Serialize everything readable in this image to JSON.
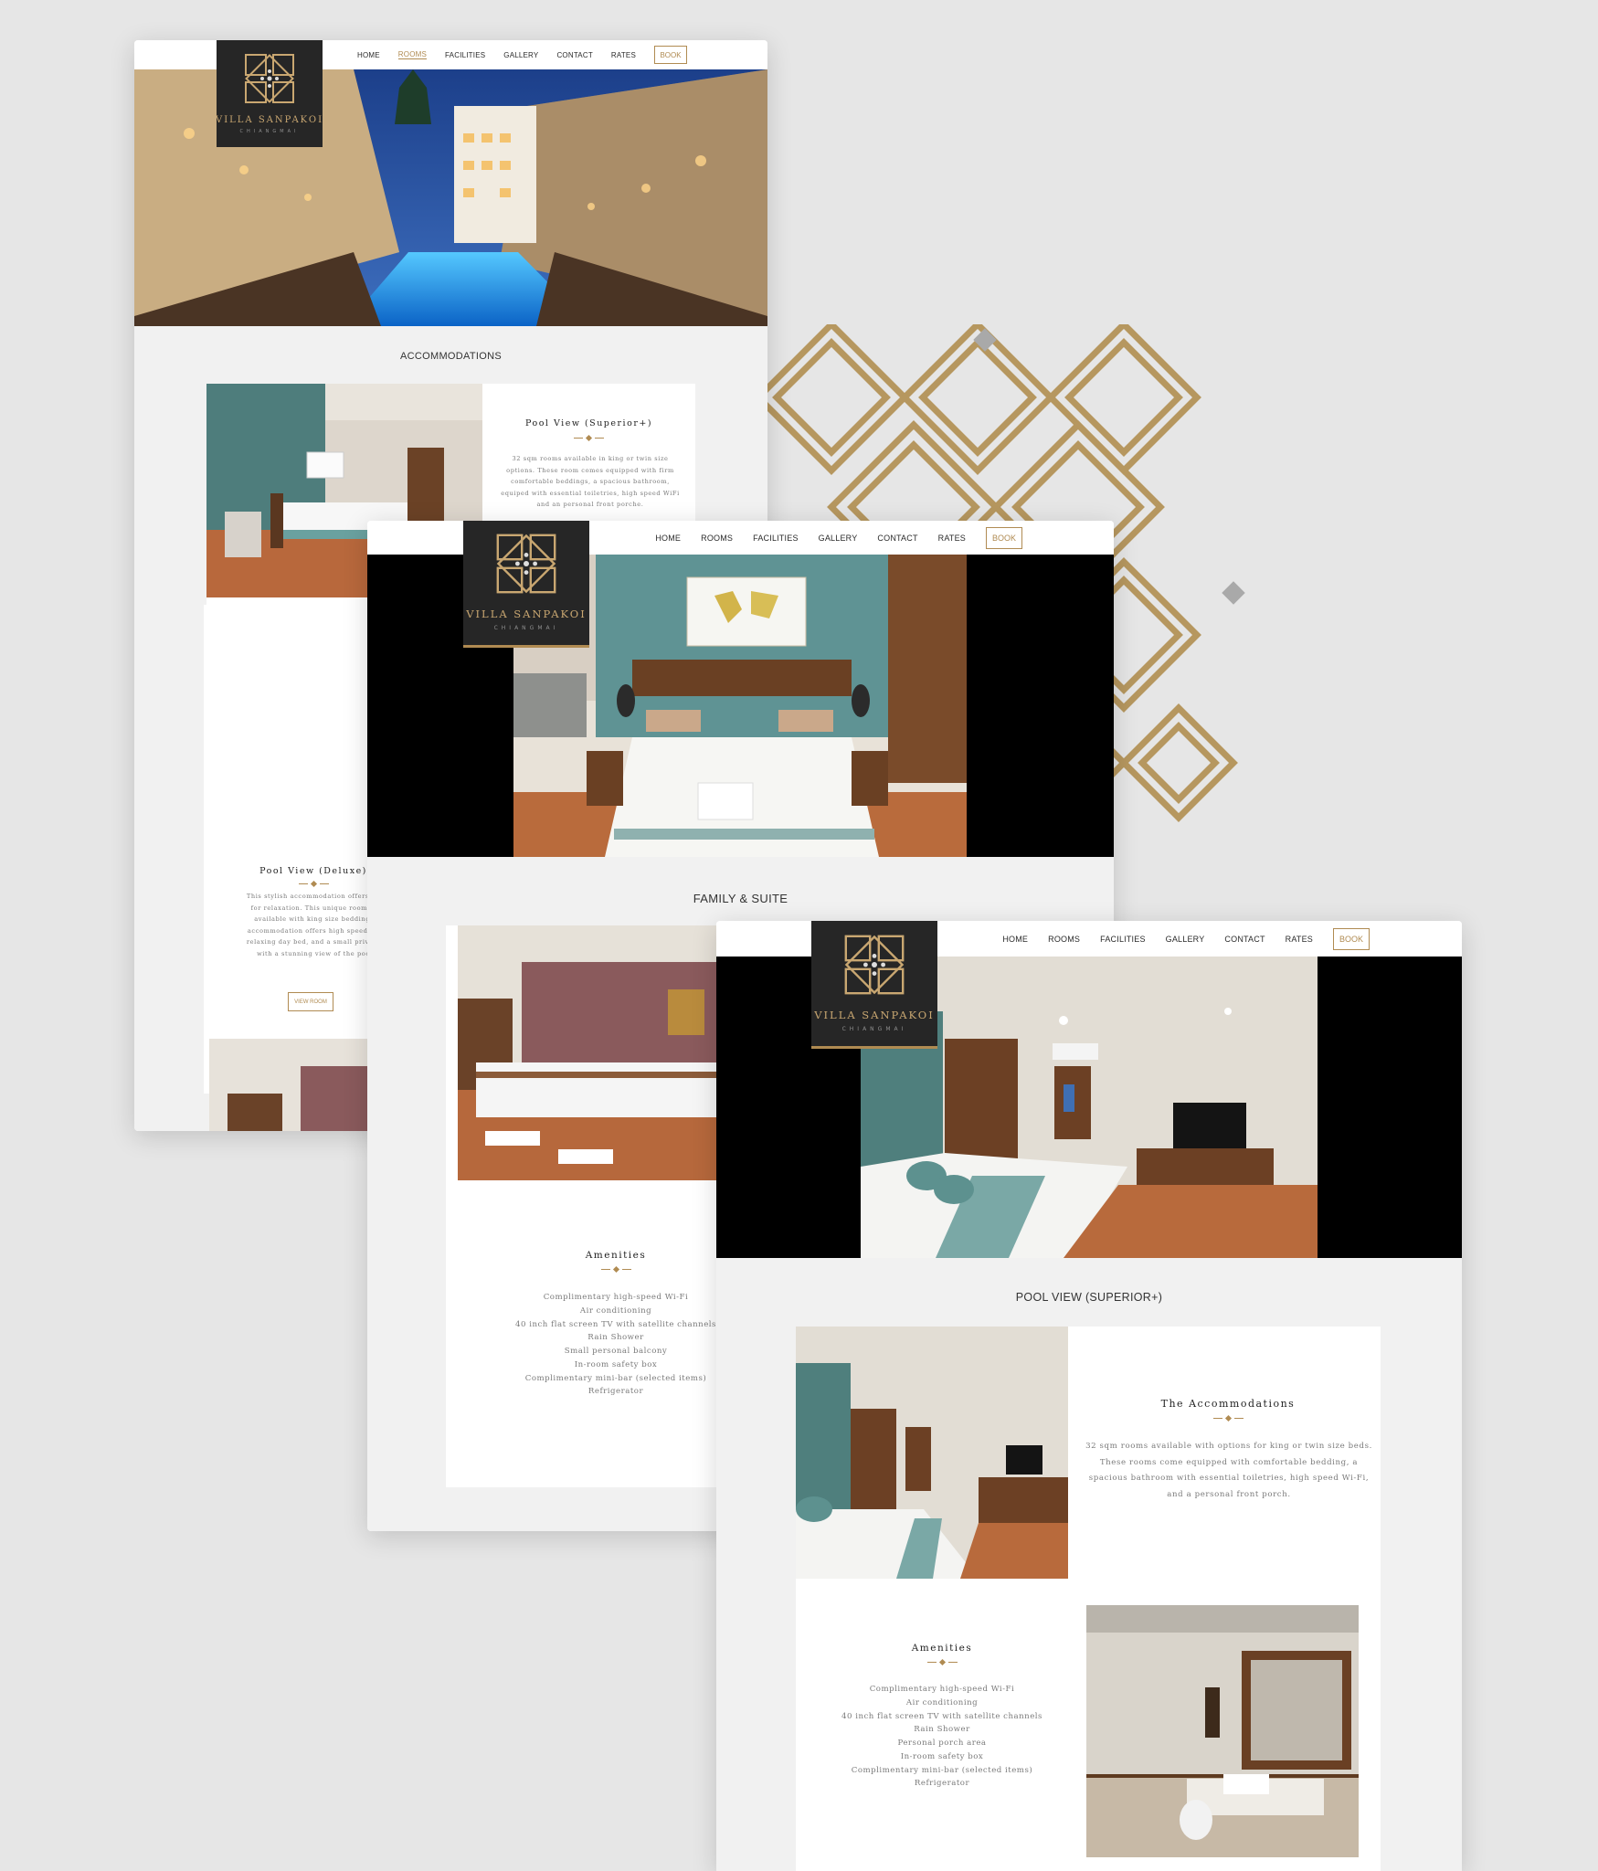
{
  "brand": {
    "name": "VILLA SANPAKOI",
    "location": "CHIANGMAI",
    "colors": {
      "gold": "#b08b52",
      "dark": "#262626",
      "background": "#e6e6e6"
    }
  },
  "nav": {
    "items": [
      "HOME",
      "ROOMS",
      "FACILITIES",
      "GALLERY",
      "CONTACT",
      "RATES"
    ],
    "book_label": "BOOK"
  },
  "screen1": {
    "active_nav": "ROOMS",
    "section_title": "ACCOMMODATIONS",
    "room1": {
      "title": "Pool View (Superior+)",
      "description": "32 sqm rooms available in king or twin size options. These room comes equipped with firm comfortable beddings, a spacious bathroom, equiped with essential toiletries, high speed WiFi and an personal front porche."
    },
    "room2": {
      "title": "Pool View (Deluxe)",
      "description_lines": [
        "This stylish accommodation offers 32",
        "for relaxation. This unique room is",
        "available with king size bedding.",
        "accommodation offers high speed Wi",
        "relaxing day bed, and a small private",
        "with a stunning view of the poo"
      ],
      "button_label": "VIEW ROOM"
    }
  },
  "screen2": {
    "section_title": "FAMILY & SUITE",
    "amenities_title": "Amenities",
    "amenities": [
      "Complimentary high-speed Wi-Fi",
      "Air conditioning",
      "40 inch flat screen TV with satellite channels",
      "Rain Shower",
      "Small personal balcony",
      "In-room safety box",
      "Complimentary mini-bar (selected items)",
      "Refrigerator"
    ]
  },
  "screen3": {
    "section_title": "POOL VIEW (SUPERIOR+)",
    "accommodations_title": "The Accommodations",
    "accommodations_text": "32 sqm rooms available with options for king or twin size beds. These rooms come equipped with comfortable bedding, a spacious bathroom with essential toiletries, high speed Wi-Fi, and a personal front porch.",
    "amenities_title": "Amenities",
    "amenities": [
      "Complimentary high-speed Wi-Fi",
      "Air conditioning",
      "40 inch flat screen TV with satellite channels",
      "Rain Shower",
      "Personal porch area",
      "In-room safety box",
      "Complimentary mini-bar (selected items)",
      "Refrigerator"
    ]
  }
}
